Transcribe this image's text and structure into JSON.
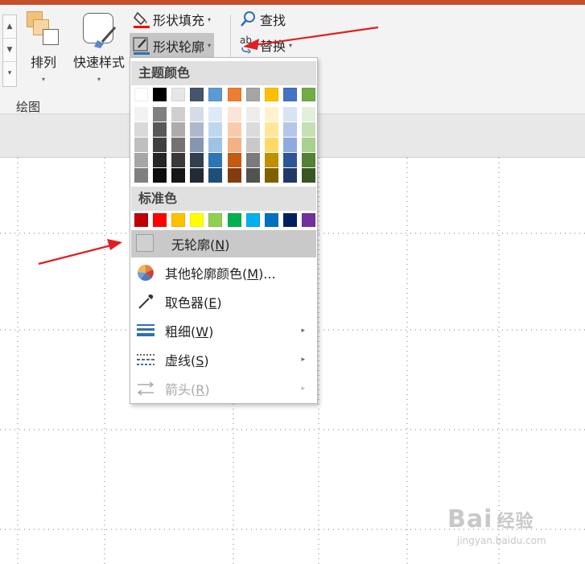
{
  "ribbon": {
    "arrange_label": "排列",
    "quick_styles_label": "快速样式",
    "shape_fill_label": "形状填充",
    "shape_outline_label": "形状轮廓",
    "find_label": "查找",
    "replace_label": "替换",
    "replace_icon_text": "ab",
    "group_label": "绘图",
    "dropdown_caret": "▾",
    "scroll_up": "▲",
    "scroll_down": "▼",
    "scroll_more": "▾"
  },
  "outline_menu": {
    "theme_colors_label": "主题颜色",
    "standard_colors_label": "标准色",
    "theme_top_row": [
      "#ffffff",
      "#000000",
      "#e7e6e6",
      "#44546a",
      "#5b9bd5",
      "#ed7d31",
      "#a5a5a5",
      "#ffc000",
      "#4472c4",
      "#70ad47"
    ],
    "theme_shades": [
      [
        "#f2f2f2",
        "#808080",
        "#d0cece",
        "#d6dce5",
        "#deebf7",
        "#fbe5d6",
        "#ededed",
        "#fff2cc",
        "#dae3f3",
        "#e2f0d9"
      ],
      [
        "#d9d9d9",
        "#595959",
        "#aeabab",
        "#adb9ca",
        "#bdd7ee",
        "#f8cbad",
        "#dbdbdb",
        "#ffe699",
        "#b4c7e7",
        "#c5e0b4"
      ],
      [
        "#bfbfbf",
        "#404040",
        "#757171",
        "#8497b0",
        "#9dc3e6",
        "#f4b183",
        "#c9c9c9",
        "#ffd966",
        "#8faadc",
        "#a9d18e"
      ],
      [
        "#a6a6a6",
        "#262626",
        "#3a3838",
        "#333f50",
        "#2e75b6",
        "#c55a11",
        "#7b7b7b",
        "#bf9000",
        "#2f5597",
        "#538135"
      ],
      [
        "#7f7f7f",
        "#0d0d0d",
        "#171616",
        "#222a35",
        "#1f4e79",
        "#843c0c",
        "#525252",
        "#7f6000",
        "#203864",
        "#375623"
      ]
    ],
    "standard_colors": [
      "#c00000",
      "#ff0000",
      "#ffc000",
      "#ffff00",
      "#92d050",
      "#00b050",
      "#00b0f0",
      "#0070c0",
      "#002060",
      "#7030a0"
    ],
    "items": [
      {
        "text": "无轮廓(",
        "key": "N",
        "end": ")",
        "icon": "no-outline-icon",
        "state": "selected"
      },
      {
        "text": "其他轮廓颜色(",
        "key": "M",
        "end": ")...",
        "icon": "color-wheel-icon"
      },
      {
        "text": "取色器(",
        "key": "E",
        "end": ")",
        "icon": "eyedropper-icon"
      },
      {
        "text": "粗细(",
        "key": "W",
        "end": ")",
        "icon": "line-weight-icon",
        "submenu": true
      },
      {
        "text": "虚线(",
        "key": "S",
        "end": ")",
        "icon": "dash-line-icon",
        "submenu": true
      },
      {
        "text": "箭头(",
        "key": "R",
        "end": ")",
        "icon": "arrow-style-icon",
        "submenu": true,
        "state": "disabled"
      }
    ],
    "submenu_arrow": "▸"
  },
  "colors": {
    "accent_bar": "#c4502a",
    "annotation_arrow": "#e02020",
    "fill_underline": "#ff0000",
    "outline_underline": "#2f6fb5"
  },
  "watermark": {
    "brand": "Bai",
    "brand_cn": "经验",
    "site": "jingyan.baidu.com"
  }
}
